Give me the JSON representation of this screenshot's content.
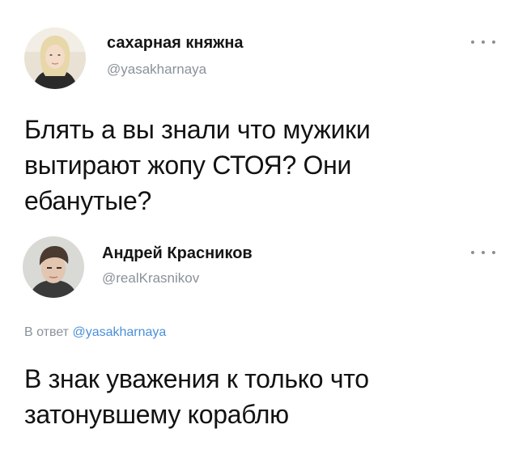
{
  "tweets": [
    {
      "display_name": "сахарная княжна",
      "handle": "@yasakharnaya",
      "avatar_icon": "user-photo-avatar",
      "more_icon": "more-options-icon",
      "text_lines": [
        "Блять а вы знали что мужики",
        "вытирают жопу СТОЯ? Они",
        "ебанутые?"
      ]
    },
    {
      "display_name": "Андрей Красников",
      "handle": "@realKrasnikov",
      "avatar_icon": "user-photo-avatar",
      "more_icon": "more-options-icon",
      "reply_prefix": "В ответ",
      "reply_handle": "@yasakharnaya",
      "text_lines": [
        "В знак уважения к только что",
        "затонувшему кораблю"
      ]
    }
  ],
  "colors": {
    "text": "#121212",
    "secondary": "#8a9199",
    "link": "#4a90d9",
    "background": "#ffffff"
  }
}
